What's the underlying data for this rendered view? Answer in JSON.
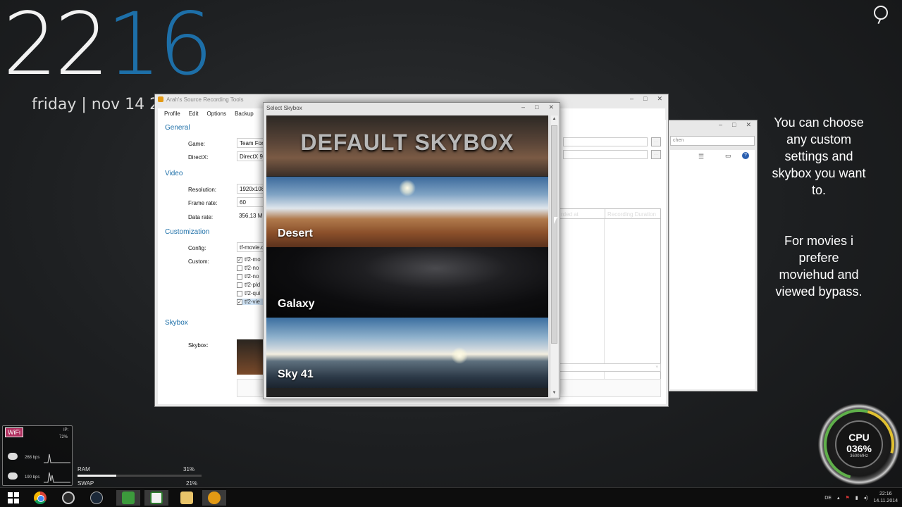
{
  "desktop": {
    "clock_hours": "22",
    "clock_minutes": "16",
    "date": "friday | nov 14 2",
    "overlay_text_1": "You can choose any custom settings and skybox you want to.",
    "overlay_text_2": "For movies i prefere moviehud and viewed bypass."
  },
  "main_window": {
    "title": "Arah's Source Recording Tools",
    "menu": [
      "Profile",
      "Edit",
      "Options",
      "Backup"
    ],
    "sections": {
      "general": "General",
      "video": "Video",
      "customization": "Customization",
      "skybox": "Skybox"
    },
    "fields": {
      "game_label": "Game:",
      "game_value": "Team Fort",
      "directx_label": "DirectX:",
      "directx_value": "DirectX 9.",
      "resolution_label": "Resolution:",
      "resolution_value": "1920x108",
      "framerate_label": "Frame rate:",
      "framerate_value": "60",
      "datarate_label": "Data rate:",
      "datarate_value": "356,13 M",
      "config_label": "Config:",
      "config_value": "tf-movie.c",
      "custom_label": "Custom:",
      "skybox_label": "Skybox:"
    },
    "custom_items": [
      {
        "label": "tf2-mo",
        "checked": true
      },
      {
        "label": "tf2-no",
        "checked": false
      },
      {
        "label": "tf2-no",
        "checked": false
      },
      {
        "label": "tf2-pld",
        "checked": false
      },
      {
        "label": "tf2-qui",
        "checked": false
      },
      {
        "label": "tf2-vie",
        "checked": true
      }
    ],
    "table_headers": [
      "rded at",
      "Recording Duration"
    ],
    "browse_label": "..."
  },
  "skybox_dialog": {
    "title": "Select Skybox",
    "items": [
      {
        "label": "DEFAULT SKYBOX"
      },
      {
        "label": "Desert"
      },
      {
        "label": "Galaxy"
      },
      {
        "label": "Sky 41"
      }
    ]
  },
  "explorer_window": {
    "search_placeholder": "chen"
  },
  "widgets": {
    "wifi_tag": "WiFi",
    "wifi_ip": "IP:",
    "wifi_signal": "72%",
    "down_rate": "268 bps",
    "up_rate": "190 bps",
    "ram_label": "RAM",
    "ram_value": "31%",
    "ram_fraction": 0.31,
    "swap_label": "SWAP",
    "swap_value": "21%",
    "swap_fraction": 0.21,
    "cpu_label": "CPU",
    "cpu_value": "036%",
    "cpu_freq": "3600MHz"
  },
  "taskbar": {
    "lang": "DE",
    "time": "22:16",
    "date": "14.11.2014"
  },
  "colors": {
    "accent": "#1d6fa8",
    "wifi_tag": "#b03060"
  }
}
